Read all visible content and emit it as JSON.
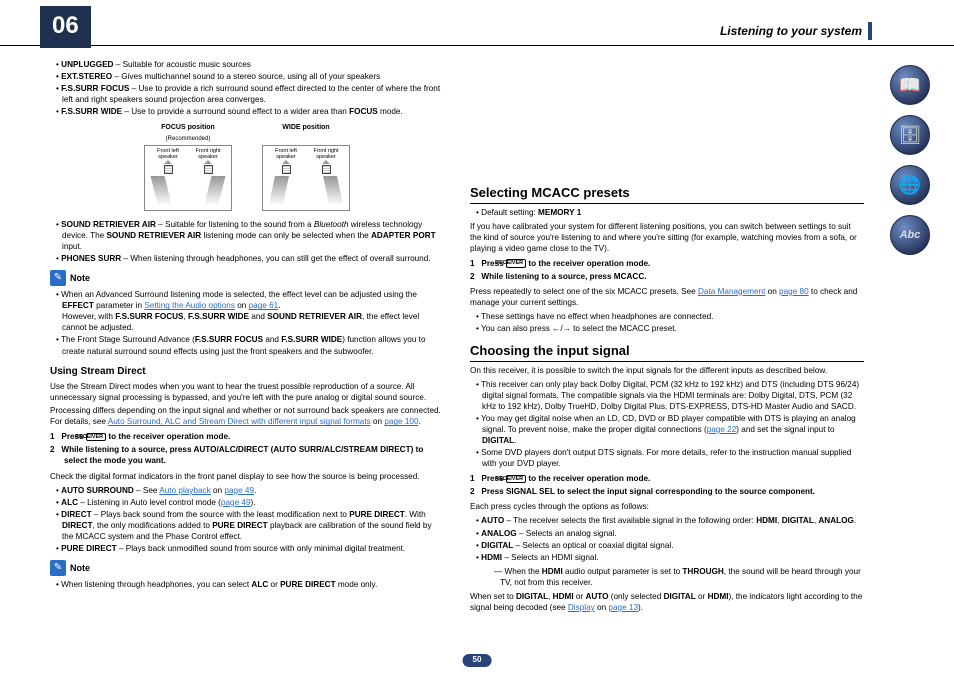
{
  "chapter": "06",
  "header_title": "Listening to your system",
  "page_number": "50",
  "side_icons": [
    "book-icon",
    "cabinet-icon",
    "globe-icon",
    "abc-icon"
  ],
  "diagram": {
    "focus_head": "FOCUS position",
    "focus_sub": "(Recommended)",
    "wide_head": "WIDE position",
    "lbl_fl": "Front left speaker",
    "lbl_fr": "Front right speaker"
  },
  "col1": {
    "surr_modes": {
      "unplugged_b": "UNPLUGGED",
      "unplugged_t": " – Suitable for acoustic music sources",
      "extstereo_b": "EXT.STEREO",
      "extstereo_t": " – Gives multichannel sound to a stereo source, using all of your speakers",
      "fsfocus_b": "F.S.SURR FOCUS",
      "fsfocus_t": " – Use to provide a rich surround sound effect directed to the center of where the front left and right speakers sound projection area converges.",
      "fswide_b": "F.S.SURR WIDE",
      "fswide_t1": " – Use to provide a surround sound effect to a wider area than ",
      "fswide_t2": "FOCUS",
      "fswide_t3": " mode."
    },
    "after_diag": {
      "sra_b": "SOUND RETRIEVER AIR",
      "sra_t1": " – Suitable for listening to the sound from a ",
      "sra_i": "Bluetooth",
      "sra_t2": " wireless technology device. The ",
      "sra_b2": "SOUND RETRIEVER AIR",
      "sra_t3": " listening mode can only be selected when the ",
      "sra_b3": "ADAPTER PORT",
      "sra_t4": " input.",
      "ph_b": "PHONES SURR",
      "ph_t": " – When listening through headphones, you can still get the effect of overall surround."
    },
    "note1": {
      "label": "Note",
      "li1a": "When an Advanced Surround listening mode is selected, the effect level can be adjusted using the ",
      "li1b": "EFFECT",
      "li1c": " parameter in ",
      "li1link": "Setting the Audio options",
      "li1d": " on ",
      "li1page": "page 61",
      "li1e": ".",
      "li1f": "However, with ",
      "li1g": "F.S.SURR FOCUS",
      "li1h": ", ",
      "li1i": "F.S.SURR WIDE",
      "li1j": " and ",
      "li1k": "SOUND RETRIEVER AIR",
      "li1l": ", the effect level cannot be adjusted.",
      "li2a": "The Front Stage Surround Advance (",
      "li2b": "F.S.SURR FOCUS",
      "li2c": " and ",
      "li2d": "F.S.SURR WIDE",
      "li2e": ") function allows you to create natural surround sound effects using just the front speakers and the subwoofer."
    },
    "stream": {
      "heading": "Using Stream Direct",
      "intro1": "Use the Stream Direct modes when you want to hear the truest possible reproduction of a source. All unnecessary signal processing is bypassed, and you're left with the pure analog or digital sound source.",
      "intro2a": "Processing differs depending on the input signal and whether or not surround back speakers are connected. For details, see ",
      "intro2link": "Auto Surround, ALC and Stream Direct with different input signal formats",
      "intro2b": " on ",
      "intro2page": "page 100",
      "intro2c": ".",
      "step1_num": "1",
      "step1a": "Press ",
      "step1btn": "RECEIVER",
      "step1b": " to the receiver operation mode.",
      "step2_num": "2",
      "step2": "While listening to a source, press AUTO/ALC/DIRECT (AUTO SURR/ALC/STREAM DIRECT) to select the mode you want.",
      "check": "Check the digital format indicators in the front panel display to see how the source is being processed.",
      "auto_b": "AUTO SURROUND",
      "auto_t1": " – See ",
      "auto_link": "Auto playback",
      "auto_t2": " on ",
      "auto_page": "page 49",
      "auto_t3": ".",
      "alc_b": "ALC",
      "alc_t1": " – Listening in Auto level control mode (",
      "alc_link": "page 49",
      "alc_t2": ").",
      "direct_b": "DIRECT",
      "direct_t1": " – Plays back sound from the source with the least modification next to ",
      "direct_b2": "PURE DIRECT",
      "direct_t2": ". With ",
      "direct_b3": "DIRECT",
      "direct_t3": ", the only modifications added to ",
      "direct_b4": "PURE DIRECT",
      "direct_t4": " playback are calibration of the sound field by the MCACC system and the Phase Control effect.",
      "pure_b": "PURE DIRECT",
      "pure_t": " – Plays back unmodified sound from source with only minimal digital treatment."
    },
    "note2": {
      "label": "Note",
      "li1a": "When listening through headphones, you can select ",
      "li1b": "ALC",
      "li1c": " or ",
      "li1d": "PURE DIRECT",
      "li1e": " mode only."
    }
  },
  "col2": {
    "mcacc": {
      "heading": "Selecting MCACC presets",
      "def_b": "MEMORY 1",
      "def_a": "Default setting: ",
      "intro": "If you have calibrated your system for different listening positions, you can switch between settings to suit the kind of source you're listening to and where you're sitting (for example, watching movies from a sofa, or playing a video game close to the TV).",
      "step1_num": "1",
      "step1a": "Press ",
      "step1btn": "RECEIVER",
      "step1b": " to the receiver operation mode.",
      "step2_num": "2",
      "step2": "While listening to a source, press MCACC.",
      "after1a": "Press repeatedly to select one of the six MCACC presets. See ",
      "after1link": "Data Management",
      "after1b": " on ",
      "after1page": "page 80",
      "after1c": " to check and manage your current settings.",
      "li1": "These settings have no effect when headphones are connected.",
      "li2a": "You can also press ",
      "li2b": "←",
      "li2c": "/",
      "li2d": "→",
      "li2e": " to select the MCACC preset."
    },
    "input": {
      "heading": "Choosing the input signal",
      "intro": "On this receiver, it is possible to switch the input signals for the different inputs as described below.",
      "li1": "This receiver can only play back Dolby Digital, PCM (32 kHz to 192 kHz) and DTS (including DTS 96/24) digital signal formats. The compatible signals via the HDMI terminals are: Dolby Digital, DTS, PCM (32 kHz to 192 kHz), Dolby TrueHD, Dolby Digital Plus, DTS-EXPRESS, DTS-HD Master Audio and SACD.",
      "li2a": "You may get digital noise when an LD, CD, DVD or BD player compatible with DTS is playing an analog signal. To prevent noise, make the proper digital connections (",
      "li2link": "page 22",
      "li2b": ") and set the signal input to ",
      "li2c": "DIGITAL",
      "li2d": ".",
      "li3": "Some DVD players don't output DTS signals. For more details, refer to the instruction manual supplied with your DVD player.",
      "step1_num": "1",
      "step1a": "Press ",
      "step1btn": "RECEIVER",
      "step1b": " to the receiver operation mode.",
      "step2_num": "2",
      "step2": "Press SIGNAL SEL to select the input signal corresponding to the source component.",
      "cycle": "Each press cycles through the options as follows:",
      "auto_b": "AUTO",
      "auto_t1": " – The receiver selects the first available signal in the following order: ",
      "auto_seq": "HDMI",
      "auto_c": ", ",
      "auto_d": "DIGITAL",
      "auto_e": ", ",
      "auto_f": "ANALOG",
      "auto_g": ".",
      "analog_b": "ANALOG",
      "analog_t": " – Selects an analog signal.",
      "digital_b": "DIGITAL",
      "digital_t": " – Selects an optical or coaxial digital signal.",
      "hdmi_b": "HDMI",
      "hdmi_t": " – Selects an HDMI signal.",
      "hdmi_sub_a": "When the ",
      "hdmi_sub_b": "HDMI",
      "hdmi_sub_c": " audio output parameter is set to ",
      "hdmi_sub_d": "THROUGH",
      "hdmi_sub_e": ", the sound will be heard through your TV, not from this receiver.",
      "tail_a": "When set to ",
      "tail_b": "DIGITAL",
      "tail_c": ", ",
      "tail_d": "HDMI",
      "tail_e": " or ",
      "tail_f": "AUTO",
      "tail_g": " (only selected ",
      "tail_h": "DIGITAL",
      "tail_i": " or ",
      "tail_j": "HDMI",
      "tail_k": "), the indicators light according to the signal being decoded (see ",
      "tail_link": "Display",
      "tail_l": " on ",
      "tail_page": "page 13",
      "tail_m": ")."
    }
  }
}
